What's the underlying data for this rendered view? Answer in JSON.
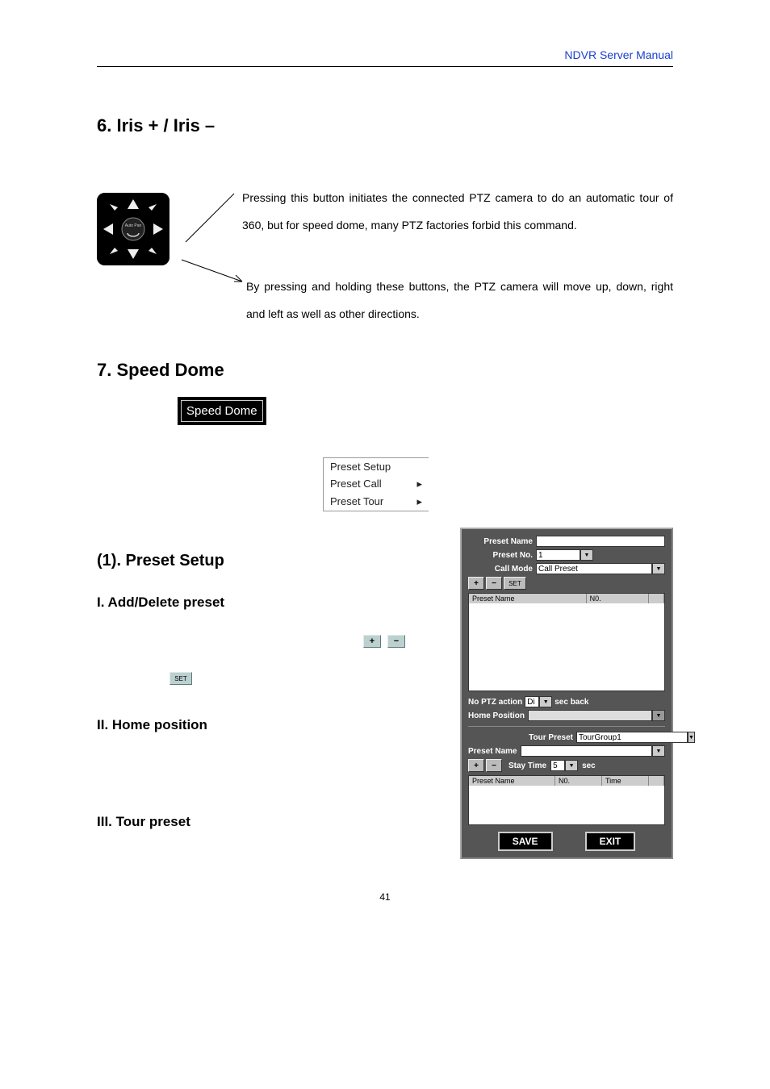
{
  "header": {
    "manual_title": "NDVR Server Manual"
  },
  "sections": {
    "iris_heading": "6. Iris + / Iris –",
    "iris_p1": "Pressing this button initiates the connected PTZ camera to do an automatic tour of 360, but for speed dome, many PTZ factories forbid this command.",
    "iris_p2": "By pressing and holding these buttons, the PTZ camera will move up, down, right and left as well as other directions.",
    "speed_dome_heading": "7. Speed Dome",
    "speed_dome_btn": "Speed Dome",
    "menu": {
      "item1": "Preset Setup",
      "item2": "Preset Call",
      "item3": "Preset Tour",
      "arrow": "▸"
    },
    "preset_setup_heading": "(1). Preset Setup",
    "add_delete_heading": "I. Add/Delete preset",
    "plus": "+",
    "minus": "−",
    "set_label": "SET",
    "home_position_heading": "II. Home position",
    "tour_preset_heading": "III. Tour preset"
  },
  "panel": {
    "preset_name_label": "Preset Name",
    "preset_name_value": "",
    "preset_no_label": "Preset No.",
    "preset_no_value": "1",
    "call_mode_label": "Call Mode",
    "call_mode_value": "Call Preset",
    "plus": "+",
    "minus": "−",
    "set": "SET",
    "list1": {
      "col1": "Preset Name",
      "col2": "N0."
    },
    "no_ptz_label": "No PTZ action",
    "no_ptz_value": "Di",
    "sec_back": "sec back",
    "home_position_label": "Home Position",
    "home_position_value": "",
    "tour_preset_label": "Tour Preset",
    "tour_preset_value": "TourGroup1",
    "preset_name2_label": "Preset Name",
    "preset_name2_value": "",
    "stay_time_label": "Stay Time",
    "stay_time_value": "5",
    "sec": "sec",
    "list2": {
      "col1": "Preset Name",
      "col2": "N0.",
      "col3": "Time"
    },
    "save": "SAVE",
    "exit": "EXIT"
  },
  "page_number": "41"
}
